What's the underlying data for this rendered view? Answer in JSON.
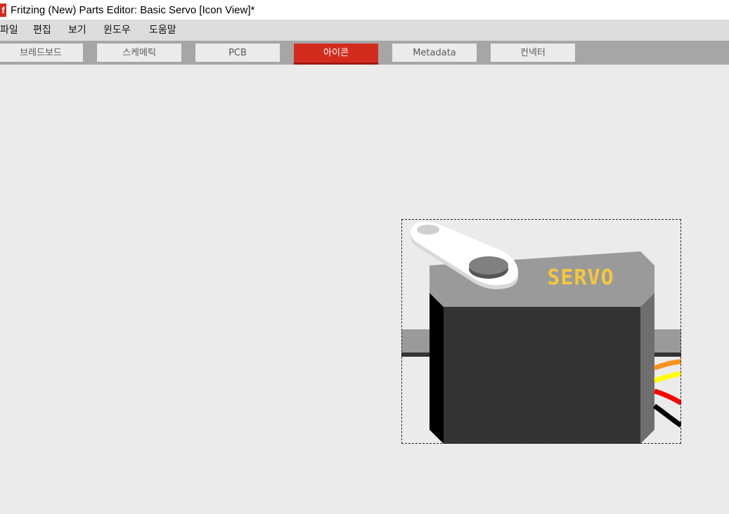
{
  "window": {
    "app_icon_letter": "f",
    "title": "Fritzing (New) Parts Editor: Basic Servo [Icon View]*"
  },
  "menu": [
    "파일",
    "편집",
    "보기",
    "윈도우",
    "도움말"
  ],
  "tabs": [
    {
      "label": "브레드보드",
      "active": false
    },
    {
      "label": "스케메틱",
      "active": false
    },
    {
      "label": "PCB",
      "active": false
    },
    {
      "label": "아이콘",
      "active": true
    },
    {
      "label": "Metadata",
      "active": false
    },
    {
      "label": "컨넥터",
      "active": false
    }
  ],
  "part": {
    "label_text": "SERVO",
    "colors": {
      "body": "#333333",
      "top": "#9a9a9a",
      "label": "#f6c63c",
      "horn": "#ffffff",
      "wire_orange": "#f7941d",
      "wire_yellow": "#ffff00",
      "wire_red": "#ff0000",
      "wire_black": "#000000"
    }
  }
}
